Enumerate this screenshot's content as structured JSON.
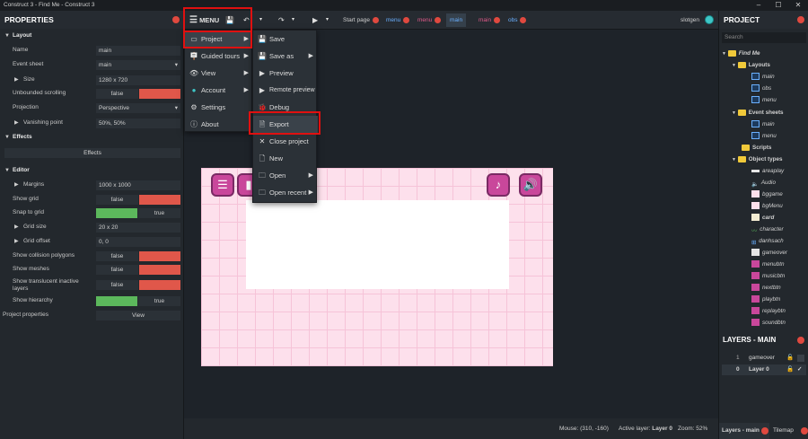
{
  "window": {
    "title": "Construct 3 - Find Me - Construct 3"
  },
  "toolbar": {
    "menu_label": "MENU",
    "tabs": [
      {
        "label": "Start page"
      },
      {
        "label": "menu"
      },
      {
        "label": "menu"
      },
      {
        "label": "main"
      },
      {
        "label": "main"
      },
      {
        "label": "obs"
      }
    ],
    "user": "slotgen"
  },
  "properties": {
    "title": "PROPERTIES",
    "layout_section": "Layout",
    "name_label": "Name",
    "name_value": "main",
    "event_sheet_label": "Event sheet",
    "event_sheet_value": "main",
    "size_label": "Size",
    "size_value": "1280 x 720",
    "unbounded_label": "Unbounded scrolling",
    "unbounded_value": "false",
    "projection_label": "Projection",
    "projection_value": "Perspective",
    "vanishing_label": "Vanishing point",
    "vanishing_value": "50%, 50%",
    "effects_section": "Effects",
    "effects_button": "Effects",
    "editor_section": "Editor",
    "margins_label": "Margins",
    "margins_value": "1000 x 1000",
    "show_grid_label": "Show grid",
    "show_grid_value": "false",
    "snap_label": "Snap to grid",
    "snap_value": "true",
    "grid_size_label": "Grid size",
    "grid_size_value": "20 x 20",
    "grid_offset_label": "Grid offset",
    "grid_offset_value": "0, 0",
    "collision_label": "Show collision polygons",
    "collision_value": "false",
    "meshes_label": "Show meshes",
    "meshes_value": "false",
    "translucent_label": "Show translucent inactive layers",
    "translucent_value": "false",
    "hierarchy_label": "Show hierarchy",
    "hierarchy_value": "true",
    "project_props_label": "Project properties",
    "project_props_button": "View"
  },
  "main_menu": {
    "items": [
      {
        "label": "Project",
        "icon": "project-icon"
      },
      {
        "label": "Guided tours",
        "icon": "tours-icon"
      },
      {
        "label": "View",
        "icon": "eye-icon"
      },
      {
        "label": "Account",
        "icon": "account-icon"
      },
      {
        "label": "Settings",
        "icon": "gear-icon"
      },
      {
        "label": "About",
        "icon": "info-icon"
      }
    ]
  },
  "project_menu": {
    "items": [
      {
        "label": "Save"
      },
      {
        "label": "Save as"
      },
      {
        "label": "Preview"
      },
      {
        "label": "Remote preview"
      },
      {
        "label": "Debug"
      },
      {
        "label": "Export"
      },
      {
        "label": "Close project"
      },
      {
        "label": "New"
      },
      {
        "label": "Open"
      },
      {
        "label": "Open recent"
      }
    ]
  },
  "status": {
    "mouse": "Mouse: (310, -160)",
    "active_layer_label": "Active layer:",
    "active_layer": "Layer 0",
    "zoom": "Zoom: 52%"
  },
  "project": {
    "title": "PROJECT",
    "search_placeholder": "Search",
    "root": "Find Me",
    "layouts_folder": "Layouts",
    "layouts": [
      "main",
      "obs",
      "menu"
    ],
    "event_sheets_folder": "Event sheets",
    "event_sheets": [
      "main",
      "menu"
    ],
    "scripts_folder": "Scripts",
    "object_types_folder": "Object types",
    "objects": [
      "areaplay",
      "Audio",
      "bggame",
      "bgMenu",
      "card",
      "character",
      "danhsach",
      "gameover",
      "menubtn",
      "musicbtn",
      "nextbtn",
      "playbtn",
      "replaybtn",
      "soundbtn"
    ]
  },
  "layers": {
    "title": "LAYERS - MAIN",
    "rows": [
      {
        "index": "1",
        "name": "gameover"
      },
      {
        "index": "0",
        "name": "Layer 0"
      }
    ]
  },
  "bottom_tabs": {
    "layers": "Layers - main",
    "tilemap": "Tilemap"
  },
  "colors": {
    "accent": "#6ab0ff",
    "false_bar": "#e0574a",
    "true_bar": "#5cb85c",
    "highlight": "#e01010",
    "layout_bg": "#fde0ec"
  }
}
